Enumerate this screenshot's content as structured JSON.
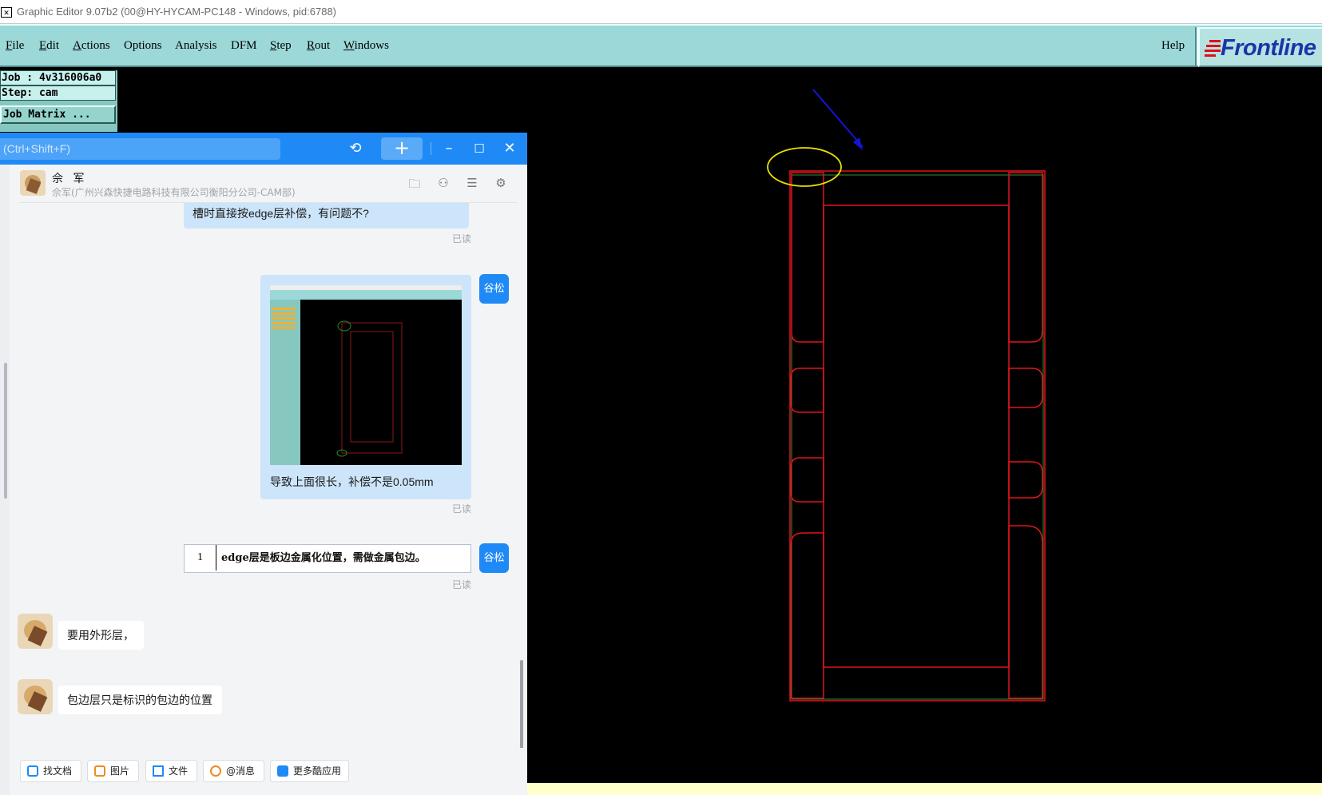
{
  "window": {
    "title": "Graphic Editor 9.07b2 (00@HY-HYCAM-PC148 - Windows, pid:6788)"
  },
  "menubar": {
    "items": [
      "File",
      "Edit",
      "Actions",
      "Options",
      "Analysis",
      "DFM",
      "Step",
      "Rout",
      "Windows"
    ],
    "help": "Help",
    "logo": "Frontline"
  },
  "job_panel": {
    "job": "Job : 4v316006a0",
    "step": "Step: cam",
    "job_matrix": "Job Matrix ..."
  },
  "chat": {
    "search_placeholder": "(Ctrl+Shift+F)",
    "contact": {
      "name": "佘 军",
      "org": "佘军(广州兴森快捷电路科技有限公司衡阳分公司-CAM部)"
    },
    "messages": [
      {
        "from": "self",
        "text": "槽时直接按edge层补偿，有问题不?",
        "status": "已读"
      },
      {
        "from": "self",
        "sender": "谷松",
        "text": "导致上面很长，补偿不是0.05mm",
        "status": "已读"
      },
      {
        "from": "self",
        "sender": "谷松",
        "quote_num": "1",
        "text": "edge层是板边金属化位置，需做金属包边。",
        "status": "已读"
      },
      {
        "from": "peer",
        "text": "要用外形层，"
      },
      {
        "from": "peer",
        "text": "包边层只是标识的包边的位置"
      }
    ],
    "toolbar": [
      "找文档",
      "图片",
      "文件",
      "@消息",
      "更多酷应用"
    ]
  },
  "colors": {
    "menubar": "#9cd8d8",
    "canvas": "#000000",
    "outline_red": "#e0141c",
    "profile_green": "#3a8a3a",
    "highlight_yellow": "#e8e000",
    "arrow_blue": "#1414d8",
    "chat_accent": "#1f8af5"
  }
}
